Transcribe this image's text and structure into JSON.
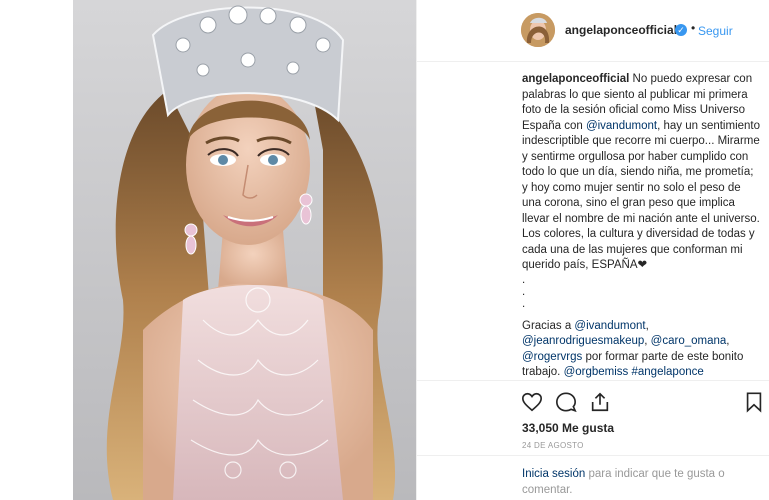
{
  "post": {
    "username": "angelaponceofficial",
    "follow_label": "Seguir",
    "separator": "•",
    "verified_mark": "✓",
    "caption": {
      "username": "angelaponceofficial",
      "text_1": " No puedo expresar con palabras lo que siento al publicar mi primera foto de la sesión oficial como Miss Universo España con ",
      "mention_1": "@ivandumont",
      "text_2": ", hay un sentimiento indescriptible que recorre mi cuerpo... Mirarme y sentirme orgullosa por haber cumplido con todo lo que un día, siendo niña, me prometía; y hoy como mujer sentir no solo el peso de una corona, sino el gran peso que implica llevar el nombre de mi nación ante el universo. Los colores, la cultura y diversidad de todas y cada una de las mujeres que conforman mi querido país, ESPAÑA❤",
      "dots": [
        ".",
        ".",
        "."
      ],
      "credits_prefix": "Gracias a ",
      "credit_mention_1": "@ivandumont",
      "credit_sep_1": ",",
      "credit_mention_2": "@jeanrodriguesmakeup",
      "credit_sep_2": ", ",
      "credit_mention_3": "@caro_omana",
      "credit_sep_3": ",",
      "credit_mention_4": "@rogervrgs",
      "credit_text": " por formar parte de este bonito trabajo. ",
      "credit_mention_5": "@orgbemiss",
      "credit_sep_5": " ",
      "hashtag": "#angelaponce"
    },
    "likes_count": "33,050",
    "likes_label": " Me gusta",
    "date": "24 DE AGOSTO",
    "login_link": "Inicia sesión",
    "login_text": " para indicar que te gusta o comentar."
  },
  "icons": {
    "like": "heart-icon",
    "comment": "comment-icon",
    "share": "share-icon",
    "save": "bookmark-icon"
  },
  "colors": {
    "link": "#003569",
    "follow": "#3897f0",
    "verified": "#3897f0",
    "muted": "#999999",
    "text": "#262626"
  }
}
